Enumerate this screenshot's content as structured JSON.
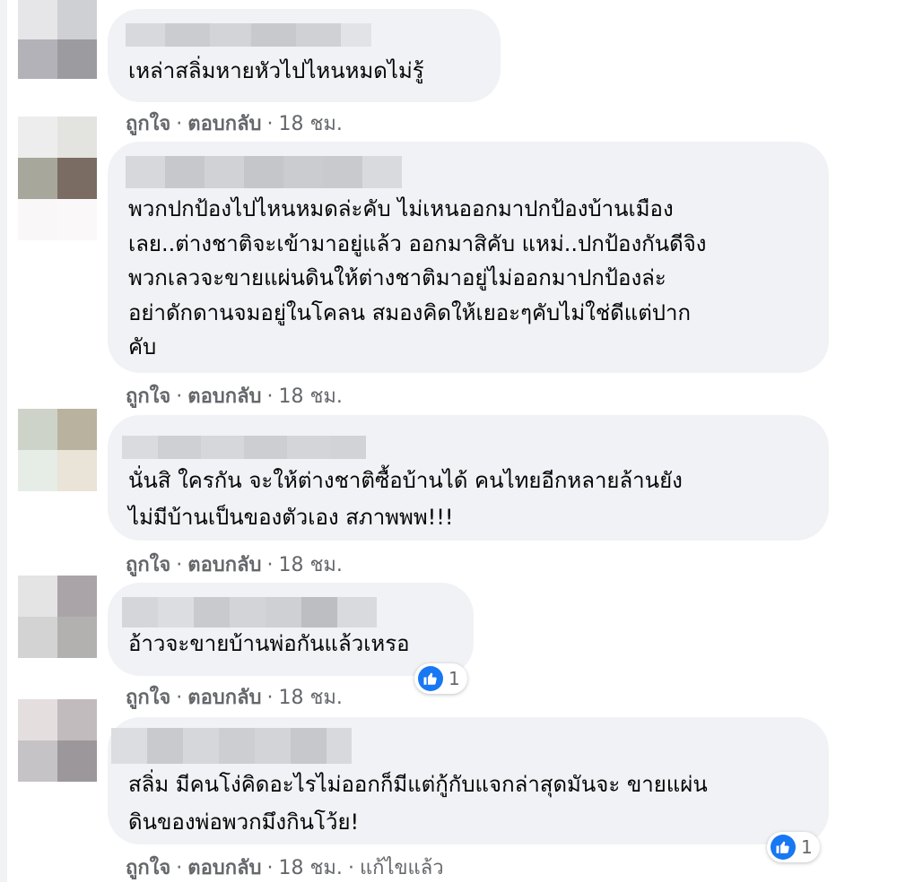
{
  "comments": [
    {
      "text_lines": [
        "เหล่าสลิ่มหายหัวไปไหนหมดไม่รู้"
      ],
      "actions": {
        "like": "ถูกใจ",
        "reply": "ตอบกลับ",
        "time": "18 ชม."
      }
    },
    {
      "text_lines": [
        "พวกปกป้องไปไหนหมดล่ะคับ ไม่เหนออกมาปกป้องบ้านเมือง",
        "เลย..ต่างชาติจะเข้ามาอยู่แล้ว ออกมาสิคับ แหม่..ปกป้องกันดีจิง",
        "พวกเลวจะขายแผ่นดินให้ต่างชาติมาอยู่ไม่ออกมาปกป้องล่ะ",
        "อย่าดักดานจมอยู่ในโคลน สมองคิดให้เยอะๆคับไม่ใช่ดีแต่ปาก",
        "คับ"
      ],
      "actions": {
        "like": "ถูกใจ",
        "reply": "ตอบกลับ",
        "time": "18 ชม."
      }
    },
    {
      "text_lines": [
        "นั่นสิ ใครกัน จะให้ต่างชาติซื้อบ้านได้ คนไทยอีกหลายล้านยัง",
        "ไม่มีบ้านเป็นของตัวเอง สภาพพพ!!!"
      ],
      "actions": {
        "like": "ถูกใจ",
        "reply": "ตอบกลับ",
        "time": "18 ชม."
      }
    },
    {
      "text_lines": [
        "อ้าวจะขายบ้านพ่อกันแล้วเหรอ"
      ],
      "actions": {
        "like": "ถูกใจ",
        "reply": "ตอบกลับ",
        "time": "18 ชม."
      },
      "reaction": {
        "icon": "thumbs-up-icon",
        "count": "1"
      }
    },
    {
      "text_lines": [
        "สลิ่ม มีคนโง่คิดอะไรไม่ออกก็มีแต่กู้กับแจกล่าสุดมันจะ ขายแผ่น",
        "ดินของพ่อพวกมึงกินโว้ย!"
      ],
      "actions": {
        "like": "ถูกใจ",
        "reply": "ตอบกลับ",
        "time": "18 ชม.",
        "edited": "แก้ไขแล้ว"
      },
      "reaction": {
        "icon": "thumbs-up-icon",
        "count": "1"
      }
    }
  ],
  "separator": "·",
  "colors": {
    "bubble": "#f0f2f5",
    "meta_text": "#65676b",
    "like_blue": "#1877f2"
  }
}
